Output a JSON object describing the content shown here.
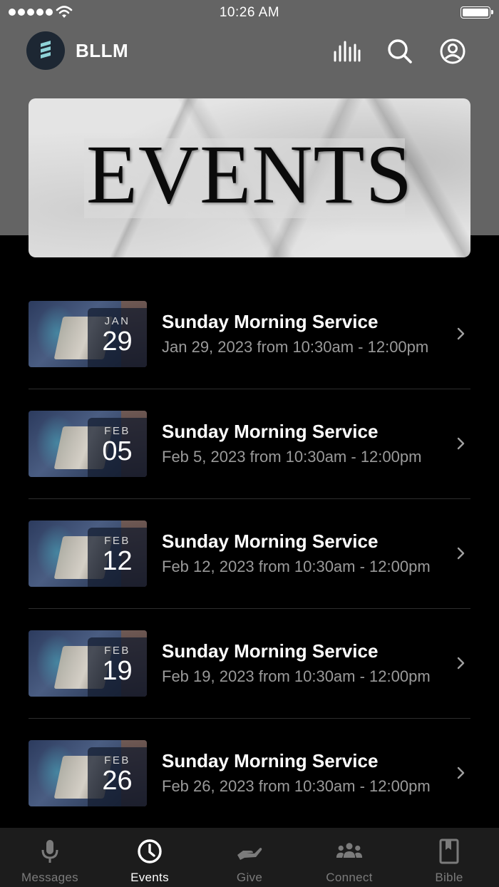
{
  "status_bar": {
    "time": "10:26 AM"
  },
  "header": {
    "title": "BLLM",
    "icons": [
      "audio-bars-icon",
      "search-icon",
      "account-icon"
    ]
  },
  "banner": {
    "text": "EVENTS"
  },
  "events": [
    {
      "month": "JAN",
      "day": "29",
      "title": "Sunday Morning Service",
      "subtitle": "Jan 29, 2023 from 10:30am - 12:00pm"
    },
    {
      "month": "FEB",
      "day": "05",
      "title": "Sunday Morning Service",
      "subtitle": "Feb 5, 2023 from 10:30am - 12:00pm"
    },
    {
      "month": "FEB",
      "day": "12",
      "title": "Sunday Morning Service",
      "subtitle": "Feb 12, 2023 from 10:30am - 12:00pm"
    },
    {
      "month": "FEB",
      "day": "19",
      "title": "Sunday Morning Service",
      "subtitle": "Feb 19, 2023 from 10:30am - 12:00pm"
    },
    {
      "month": "FEB",
      "day": "26",
      "title": "Sunday Morning Service",
      "subtitle": "Feb 26, 2023 from 10:30am - 12:00pm"
    }
  ],
  "tabs": [
    {
      "label": "Messages",
      "icon": "microphone-icon",
      "active": false
    },
    {
      "label": "Events",
      "icon": "clock-icon",
      "active": true
    },
    {
      "label": "Give",
      "icon": "giving-hand-icon",
      "active": false
    },
    {
      "label": "Connect",
      "icon": "people-icon",
      "active": false
    },
    {
      "label": "Bible",
      "icon": "bookmark-book-icon",
      "active": false
    }
  ],
  "colors": {
    "header_bg": "#646464",
    "page_bg": "#000000",
    "tab_bar_bg": "#1c1c1c",
    "active_tab": "#ffffff",
    "inactive_tab": "#7b7b7b"
  }
}
